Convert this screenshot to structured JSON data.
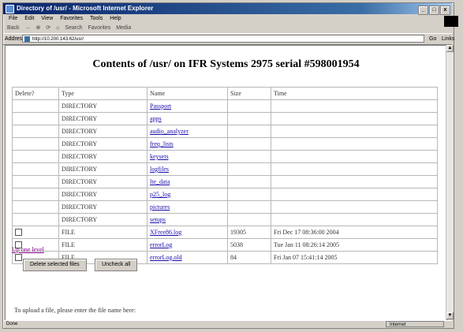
{
  "window": {
    "title": "Directory of /usr/ - Microsoft Internet Explorer",
    "controls": [
      "_",
      "□",
      "x"
    ]
  },
  "menu": [
    "File",
    "Edit",
    "View",
    "Favorites",
    "Tools",
    "Help"
  ],
  "toolbar": [
    "Back",
    "Search",
    "Favorites",
    "Media"
  ],
  "address": {
    "label": "Address",
    "url": "http://10.200.143.62/usr/",
    "go_label": "Go",
    "links_label": "Links"
  },
  "page": {
    "heading": "Contents of /usr/ on IFR Systems 2975 serial #598001954",
    "columns": [
      "Delete?",
      "Type",
      "Name",
      "Size",
      "Time"
    ],
    "rows": [
      {
        "checkbox": false,
        "type": "DIRECTORY",
        "name": "Passport",
        "size": "",
        "time": ""
      },
      {
        "checkbox": false,
        "type": "DIRECTORY",
        "name": "apps",
        "size": "",
        "time": ""
      },
      {
        "checkbox": false,
        "type": "DIRECTORY",
        "name": "audio_analyzer",
        "size": "",
        "time": ""
      },
      {
        "checkbox": false,
        "type": "DIRECTORY",
        "name": "freq_lists",
        "size": "",
        "time": ""
      },
      {
        "checkbox": false,
        "type": "DIRECTORY",
        "name": "keysets",
        "size": "",
        "time": ""
      },
      {
        "checkbox": false,
        "type": "DIRECTORY",
        "name": "logfiles",
        "size": "",
        "time": ""
      },
      {
        "checkbox": false,
        "type": "DIRECTORY",
        "name": "lte_data",
        "size": "",
        "time": ""
      },
      {
        "checkbox": false,
        "type": "DIRECTORY",
        "name": "p25_log",
        "size": "",
        "time": ""
      },
      {
        "checkbox": false,
        "type": "DIRECTORY",
        "name": "pictures",
        "size": "",
        "time": ""
      },
      {
        "checkbox": false,
        "type": "DIRECTORY",
        "name": "setups",
        "size": "",
        "time": ""
      },
      {
        "checkbox": true,
        "type": "FILE",
        "name": "XFree86.log",
        "size": "19305",
        "time": "Fri Dec 17 08:36:00 2004"
      },
      {
        "checkbox": true,
        "type": "FILE",
        "name": "errorLog",
        "size": "5038",
        "time": "Tue Jan 11 08:26:14 2005"
      },
      {
        "checkbox": true,
        "type": "FILE",
        "name": "errorLog.old",
        "size": "84",
        "time": "Fri Jan 07 15:41:14 2005"
      }
    ],
    "up_link": "Up one level",
    "buttons": {
      "delete": "Delete selected files",
      "uncheck": "Uncheck all"
    },
    "upload_text": "To upload a file, please enter the file name here:"
  },
  "status": {
    "text": "Done",
    "zone": "Internet"
  }
}
